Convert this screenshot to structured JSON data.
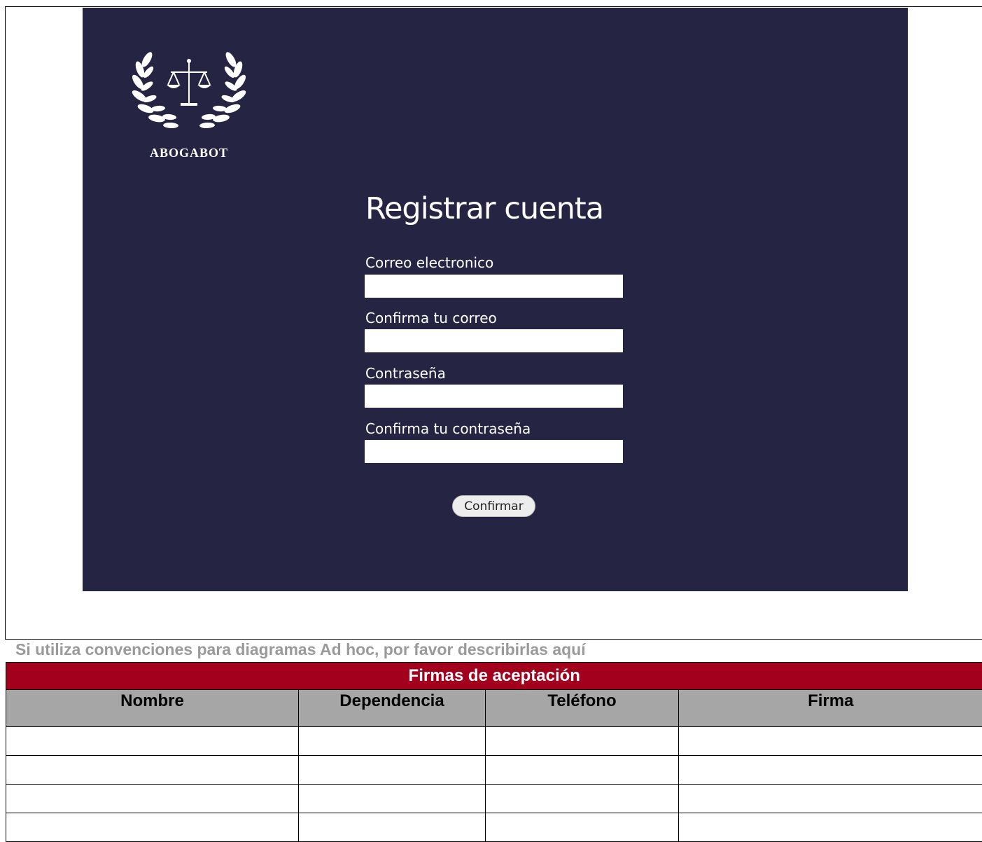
{
  "mockup": {
    "brand": "ABOGABOT",
    "title": "Registrar cuenta",
    "fields": [
      {
        "label": "Correo electronico",
        "value": ""
      },
      {
        "label": "Confirma tu correo",
        "value": ""
      },
      {
        "label": "Contraseña",
        "value": ""
      },
      {
        "label": "Confirma tu contraseña",
        "value": ""
      }
    ],
    "confirm_label": "Confirmar",
    "colors": {
      "background": "#252543",
      "text": "#ffffff",
      "button": "#ededed"
    },
    "logo_icon": "scales-of-justice-laurel-icon"
  },
  "note": "Si utiliza convenciones para diagramas Ad hoc, por favor describirlas aquí",
  "signatures": {
    "title": "Firmas de aceptación",
    "columns": [
      "Nombre",
      "Dependencia",
      "Teléfono",
      "Firma"
    ],
    "rows": [
      [
        "",
        "",
        "",
        ""
      ],
      [
        "",
        "",
        "",
        ""
      ],
      [
        "",
        "",
        "",
        ""
      ],
      [
        "",
        "",
        "",
        ""
      ]
    ],
    "colors": {
      "banner": "#a3001e",
      "header": "#a6a6a6"
    }
  }
}
